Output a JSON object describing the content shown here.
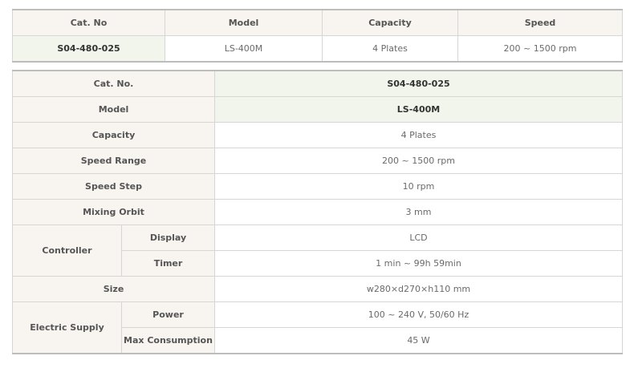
{
  "summary": {
    "headers": [
      "Cat. No",
      "Model",
      "Capacity",
      "Speed"
    ],
    "row": [
      "S04-480-025",
      "LS-400M",
      "4 Plates",
      "200 ~ 1500 rpm"
    ]
  },
  "spec": {
    "cat_no": {
      "label": "Cat. No.",
      "value": "S04-480-025"
    },
    "model": {
      "label": "Model",
      "value": "LS-400M"
    },
    "capacity": {
      "label": "Capacity",
      "value": "4 Plates"
    },
    "speed_range": {
      "label": "Speed Range",
      "value": "200 ~ 1500 rpm"
    },
    "speed_step": {
      "label": "Speed Step",
      "value": "10 rpm"
    },
    "mixing_orbit": {
      "label": "Mixing Orbit",
      "value": "3 mm"
    },
    "controller": {
      "label": "Controller",
      "display": {
        "label": "Display",
        "value": "LCD"
      },
      "timer": {
        "label": "Timer",
        "value": "1 min ~ 99h 59min"
      }
    },
    "size": {
      "label": "Size",
      "value": "w280×d270×h110 mm"
    },
    "electric_supply": {
      "label": "Electric Supply",
      "power": {
        "label": "Power",
        "value": "100 ~ 240 V, 50/60 Hz"
      },
      "max_consumption": {
        "label": "Max Consumption",
        "value": "45 W"
      }
    }
  }
}
